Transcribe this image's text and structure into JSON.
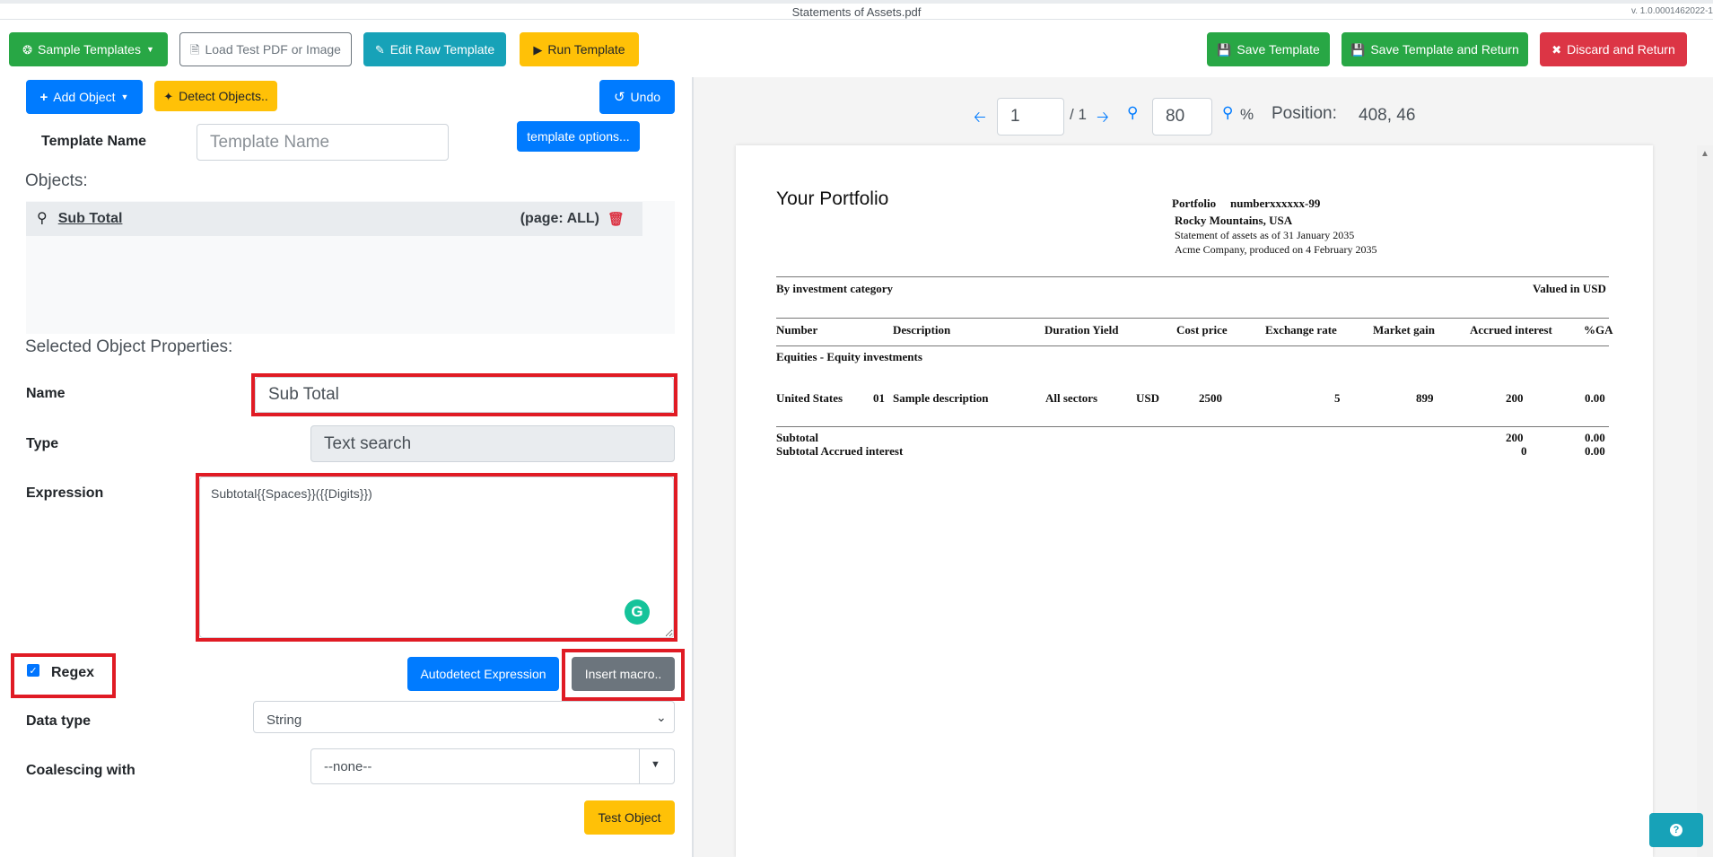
{
  "window": {
    "title": "Statements of Assets.pdf",
    "version": "v. 1.0.0001462022-1"
  },
  "toolbar": {
    "sample_templates": "Sample Templates",
    "load_test": "Load Test PDF or Image",
    "edit_raw": "Edit Raw Template",
    "run_template": "Run Template",
    "save_template": "Save Template",
    "save_and_return": "Save Template and Return",
    "discard_and_return": "Discard and Return"
  },
  "left": {
    "add_object": "Add Object",
    "detect_objects": "Detect Objects..",
    "undo": "Undo",
    "template_name_label": "Template Name",
    "template_name_placeholder": "Template Name",
    "template_options": "template options...",
    "objects_label": "Objects:",
    "objects": [
      {
        "name": "Sub Total",
        "page": "(page: ALL)"
      }
    ],
    "selected_props_label": "Selected Object Properties:",
    "name_label": "Name",
    "name_value": "Sub Total",
    "type_label": "Type",
    "type_value": "Text search",
    "expression_label": "Expression",
    "expression_value": "Subtotal{{Spaces}}({{Digits}})",
    "regex_label": "Regex",
    "autodetect": "Autodetect Expression",
    "insert_macro": "Insert macro..",
    "data_type_label": "Data type",
    "data_type_value": "String",
    "coalescing_label": "Coalescing with",
    "coalescing_value": "--none--",
    "test_object": "Test Object"
  },
  "viewer": {
    "page_value": "1",
    "page_total": "/ 1",
    "zoom_value": "80",
    "zoom_unit": "%",
    "position_label": "Position:",
    "position_value": "408, 46"
  },
  "pdf": {
    "heading": "Your Portfolio",
    "portfolio_label": "Portfolio",
    "portfolio_number": "numberxxxxxx-99",
    "location": "Rocky Mountains, USA",
    "statement_line": "Statement of assets as of 31 January 2035",
    "produced_line": "Acme Company, produced on 4 February 2035",
    "category_label": "By investment category",
    "valued_in": "Valued in USD",
    "columns": [
      "Number",
      "Description",
      "Duration Yield",
      "Cost price",
      "Exchange rate",
      "Market gain",
      "Accrued interest",
      "%GA"
    ],
    "section": "Equities - Equity investments",
    "row": {
      "number": "United States",
      "code": "01",
      "description": "Sample description",
      "sector": "All sectors",
      "currency": "USD",
      "cost": "2500",
      "exchange": "5",
      "market_gain": "899",
      "accrued": "200",
      "ga": "0.00"
    },
    "subtotal_label": "Subtotal",
    "subtotal_accrued_label": "Subtotal Accrued interest",
    "subtotal_value": "200",
    "subtotal_ga": "0.00",
    "subtotal_accrued_value": "0",
    "subtotal_accrued_ga": "0.00"
  },
  "colors": {
    "highlight": "#e01b24",
    "primary": "#007bff",
    "success": "#28a745",
    "warning": "#ffc107",
    "danger": "#dc3545",
    "info": "#17a2b8"
  },
  "icons": [
    "life-ring-icon",
    "file-pdf-icon",
    "edit-icon",
    "play-icon",
    "save-icon",
    "close-icon",
    "plus-icon",
    "magic-wand-icon",
    "undo-icon",
    "search-icon",
    "trash-icon",
    "arrow-left-icon",
    "arrow-right-icon",
    "zoom-out-icon",
    "zoom-in-icon",
    "question-icon",
    "chevron-down-icon",
    "grammarly-icon"
  ]
}
